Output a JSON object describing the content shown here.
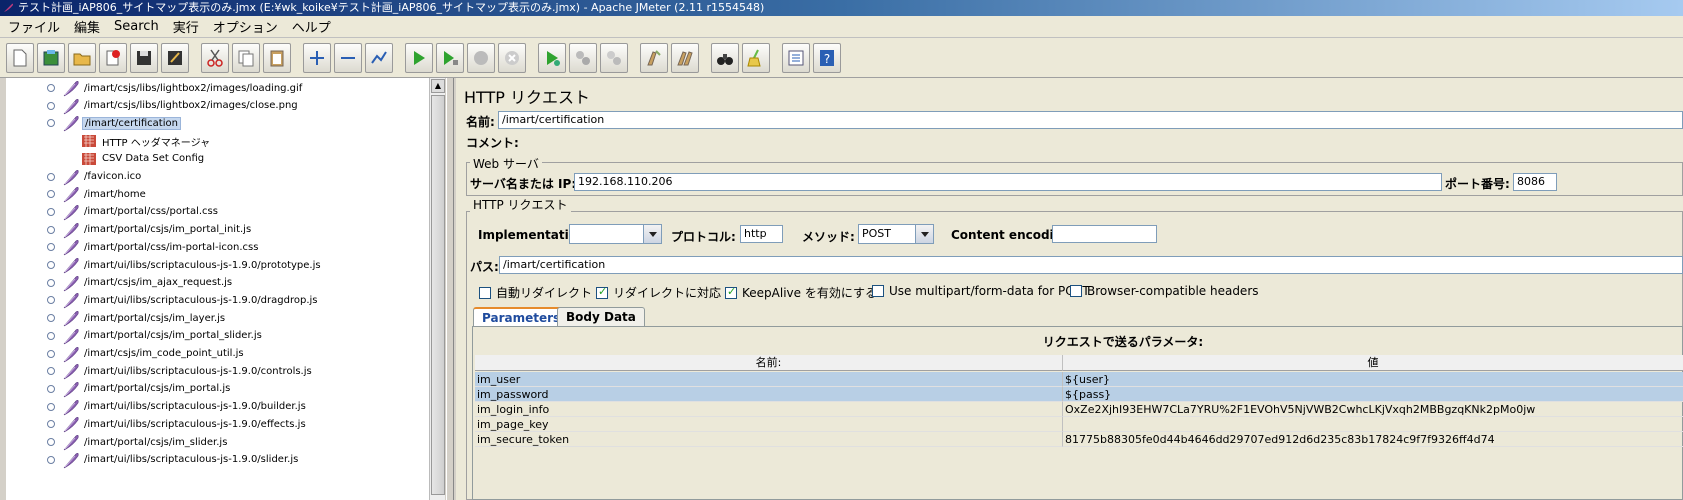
{
  "window": {
    "title": "テスト計画_iAP806_サイトマップ表示のみ.jmx (E:¥wk_koike¥テスト計画_iAP806_サイトマップ表示のみ.jmx) - Apache JMeter (2.11 r1554548)"
  },
  "menu": [
    "ファイル",
    "編集",
    "Search",
    "実行",
    "オプション",
    "ヘルプ"
  ],
  "toolbar": {
    "icons": [
      "new-icon",
      "templates-icon",
      "open-icon",
      "close-icon",
      "save-icon",
      "save-as-icon",
      "cut-icon",
      "copy-icon",
      "paste-icon",
      "expand-icon",
      "collapse-icon",
      "toggle-icon",
      "start-icon",
      "start-no-pause-icon",
      "stop-icon",
      "shutdown-icon",
      "remote-start-icon",
      "remote-stop-icon",
      "remote-shutdown-icon",
      "clear-icon",
      "clear-all-icon",
      "search-icon",
      "reset-search-icon",
      "function-helper-icon",
      "help-icon"
    ]
  },
  "tree": {
    "items": [
      {
        "label": "/imart/csjs/libs/lightbox2/images/loading.gif",
        "type": "sampler",
        "depth": 0
      },
      {
        "label": "/imart/csjs/libs/lightbox2/images/close.png",
        "type": "sampler",
        "depth": 0
      },
      {
        "label": "/imart/certification",
        "type": "sampler",
        "depth": 0,
        "selected": true,
        "expanded": true
      },
      {
        "label": "HTTP ヘッダマネージャ",
        "type": "config",
        "depth": 1
      },
      {
        "label": "CSV Data Set Config",
        "type": "config",
        "depth": 1
      },
      {
        "label": "/favicon.ico",
        "type": "sampler",
        "depth": 0
      },
      {
        "label": "/imart/home",
        "type": "sampler",
        "depth": 0
      },
      {
        "label": "/imart/portal/css/portal.css",
        "type": "sampler",
        "depth": 0
      },
      {
        "label": "/imart/portal/csjs/im_portal_init.js",
        "type": "sampler",
        "depth": 0
      },
      {
        "label": "/imart/portal/css/im-portal-icon.css",
        "type": "sampler",
        "depth": 0
      },
      {
        "label": "/imart/ui/libs/scriptaculous-js-1.9.0/prototype.js",
        "type": "sampler",
        "depth": 0
      },
      {
        "label": "/imart/csjs/im_ajax_request.js",
        "type": "sampler",
        "depth": 0
      },
      {
        "label": "/imart/ui/libs/scriptaculous-js-1.9.0/dragdrop.js",
        "type": "sampler",
        "depth": 0
      },
      {
        "label": "/imart/portal/csjs/im_layer.js",
        "type": "sampler",
        "depth": 0
      },
      {
        "label": "/imart/portal/csjs/im_portal_slider.js",
        "type": "sampler",
        "depth": 0
      },
      {
        "label": "/imart/csjs/im_code_point_util.js",
        "type": "sampler",
        "depth": 0
      },
      {
        "label": "/imart/ui/libs/scriptaculous-js-1.9.0/controls.js",
        "type": "sampler",
        "depth": 0
      },
      {
        "label": "/imart/portal/csjs/im_portal.js",
        "type": "sampler",
        "depth": 0
      },
      {
        "label": "/imart/ui/libs/scriptaculous-js-1.9.0/builder.js",
        "type": "sampler",
        "depth": 0
      },
      {
        "label": "/imart/ui/libs/scriptaculous-js-1.9.0/effects.js",
        "type": "sampler",
        "depth": 0
      },
      {
        "label": "/imart/portal/csjs/im_slider.js",
        "type": "sampler",
        "depth": 0
      },
      {
        "label": "/imart/ui/libs/scriptaculous-js-1.9.0/slider.js",
        "type": "sampler",
        "depth": 0
      }
    ]
  },
  "panel": {
    "title": "HTTP リクエスト",
    "name_label": "名前:",
    "name_value": "/imart/certification",
    "comment_label": "コメント:",
    "web_server": {
      "group_title": "Web サーバ",
      "server_label": "サーバ名または IP:",
      "server_value": "192.168.110.206",
      "port_label": "ポート番号:",
      "port_value": "8086"
    },
    "http_request": {
      "group_title": "HTTP リクエスト",
      "implementation_label": "Implementation:",
      "implementation_value": "",
      "protocol_label": "プロトコル:",
      "protocol_value": "http",
      "method_label": "メソッド:",
      "method_value": "POST",
      "encoding_label": "Content encoding:",
      "encoding_value": "",
      "path_label": "パス:",
      "path_value": "/imart/certification"
    },
    "checks": [
      {
        "label": "自動リダイレクト",
        "checked": false
      },
      {
        "label": "リダイレクトに対応",
        "checked": true
      },
      {
        "label": "KeepAlive を有効にする",
        "checked": true
      },
      {
        "label": "Use multipart/form-data for POST",
        "checked": false
      },
      {
        "label": "Browser-compatible headers",
        "checked": false
      }
    ],
    "tabs": [
      {
        "label": "Parameters",
        "active": true
      },
      {
        "label": "Body Data",
        "active": false
      }
    ],
    "params": {
      "title": "リクエストで送るパラメータ:",
      "col_name": "名前:",
      "col_value": "値",
      "rows": [
        {
          "name": "im_user",
          "value": "${user}",
          "selected": true
        },
        {
          "name": "im_password",
          "value": "${pass}",
          "selected": true
        },
        {
          "name": "im_login_info",
          "value": "OxZe2XjhI93EHW7CLa7YRU%2F1EVOhV5NjVWB2CwhcLKjVxqh2MBBgzqKNk2pMo0jw",
          "selected": false
        },
        {
          "name": "im_page_key",
          "value": "",
          "selected": false
        },
        {
          "name": "im_secure_token",
          "value": "81775b88305fe0d44b4646dd29707ed912d6d235c83b17824c9f7f9326ff4d74",
          "selected": false
        }
      ]
    }
  },
  "colors": {
    "title_gradient_start": "#0a246a",
    "selection": "#c5d7ee",
    "table_selection": "#b8cfe5",
    "tab_accent": "#e68b2c"
  }
}
